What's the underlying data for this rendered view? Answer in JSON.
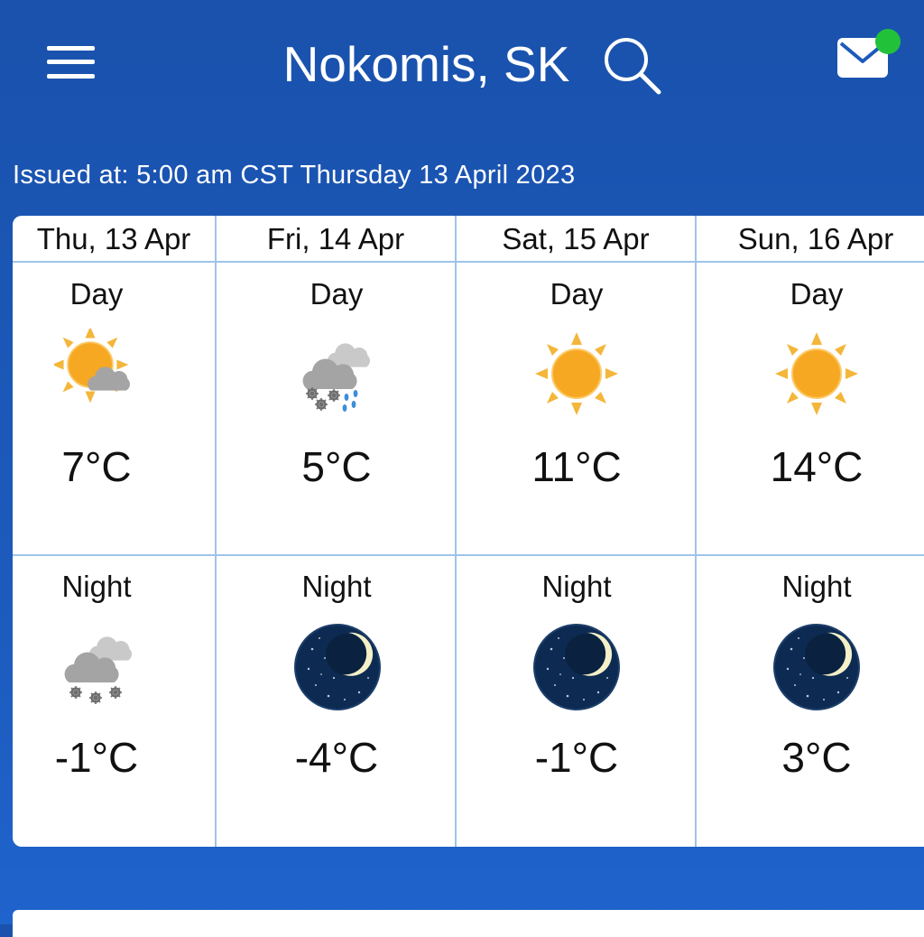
{
  "header": {
    "location": "Nokomis, SK",
    "menu_icon": "hamburger-menu-icon",
    "search_icon": "search-icon",
    "mail_icon": "mail-icon",
    "notification_color": "#21c13a"
  },
  "issued": "Issued at: 5:00 am CST Thursday 13 April 2023",
  "forecast": [
    {
      "date": "Thu, 13 Apr",
      "day": {
        "label": "Day",
        "icon": "sun-cloud-icon",
        "temp": "7°C"
      },
      "night": {
        "label": "Night",
        "icon": "cloud-snow-icon",
        "temp": "-1°C"
      }
    },
    {
      "date": "Fri, 14 Apr",
      "day": {
        "label": "Day",
        "icon": "cloud-rain-snow-icon",
        "temp": "5°C"
      },
      "night": {
        "label": "Night",
        "icon": "moon-icon",
        "temp": "-4°C"
      }
    },
    {
      "date": "Sat, 15 Apr",
      "day": {
        "label": "Day",
        "icon": "sun-icon",
        "temp": "11°C"
      },
      "night": {
        "label": "Night",
        "icon": "moon-icon",
        "temp": "-1°C"
      }
    },
    {
      "date": "Sun, 16 Apr",
      "day": {
        "label": "Day",
        "icon": "sun-icon",
        "temp": "14°C"
      },
      "night": {
        "label": "Night",
        "icon": "moon-icon",
        "temp": "3°C"
      }
    }
  ],
  "colors": {
    "background": "#1c5abb",
    "sun": "#f7a823",
    "sun_rays": "#f4b63a",
    "cloud": "#a9a9a9",
    "moon_sky": "#0d2b52",
    "moon": "#f4f0c8",
    "grid": "#9fc4e8"
  }
}
